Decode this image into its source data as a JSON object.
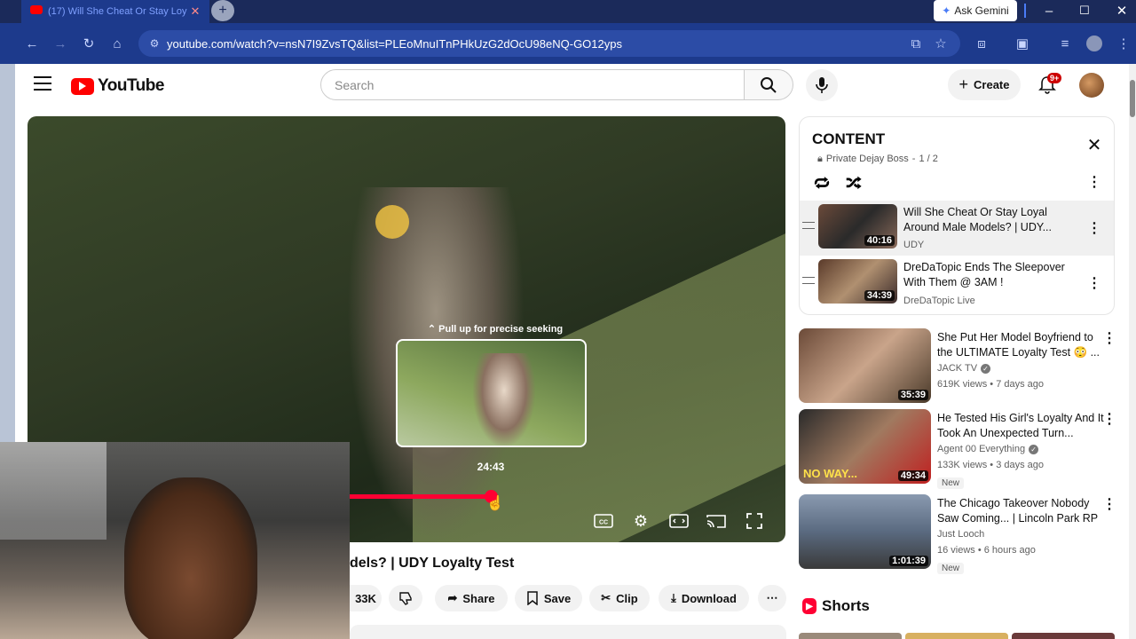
{
  "browser": {
    "tab_title": "(17) Will She Cheat Or Stay Loy",
    "url": "youtube.com/watch?v=nsN7I9ZvsTQ&list=PLEoMnuITnPHkUzG2dOcU98eNQ-GO12yps",
    "gemini_label": "Ask Gemini"
  },
  "header": {
    "logo_text": "YouTube",
    "search_placeholder": "Search",
    "create_label": "Create",
    "notification_count": "9+"
  },
  "player": {
    "seek_hint": "Pull up for precise seeking",
    "seek_time": "24:43",
    "progress_fraction": 0.6
  },
  "video": {
    "title_visible": "dels? | UDY Loyalty Test",
    "like_count": "33K",
    "share_label": "Share",
    "save_label": "Save",
    "clip_label": "Clip",
    "download_label": "Download"
  },
  "playlist": {
    "title": "CONTENT",
    "subtitle": "Private Dejay Boss",
    "position": "1 / 2",
    "items": [
      {
        "title": "Will She Cheat Or Stay Loyal Around Male Models? | UDY...",
        "channel": "UDY",
        "duration": "40:16",
        "active": true
      },
      {
        "title": "DreDaTopic Ends The Sleepover With Them @ 3AM !",
        "channel": "DreDaTopic Live",
        "duration": "34:39",
        "active": false
      }
    ]
  },
  "recommendations": [
    {
      "title": "She Put Her Model Boyfriend to the ULTIMATE Loyalty Test 😳 ...",
      "channel": "JACK TV",
      "verified": true,
      "meta": "619K views • 7 days ago",
      "duration": "35:39",
      "new": ""
    },
    {
      "title": "He Tested His Girl's Loyalty And It Took An Unexpected Turn...",
      "channel": "Agent 00 Everything",
      "verified": true,
      "meta": "133K views • 3 days ago",
      "duration": "49:34",
      "new": "New"
    },
    {
      "title": "The Chicago Takeover Nobody Saw Coming... | Lincoln Park RP",
      "channel": "Just Looch",
      "verified": false,
      "meta": "16 views • 6 hours ago",
      "duration": "1:01:39",
      "new": "New"
    }
  ],
  "shorts": {
    "label": "Shorts"
  },
  "colors": {
    "brand_red": "#ff0000",
    "progress": "#ff0033",
    "chrome_blue": "#1d3a8c"
  }
}
